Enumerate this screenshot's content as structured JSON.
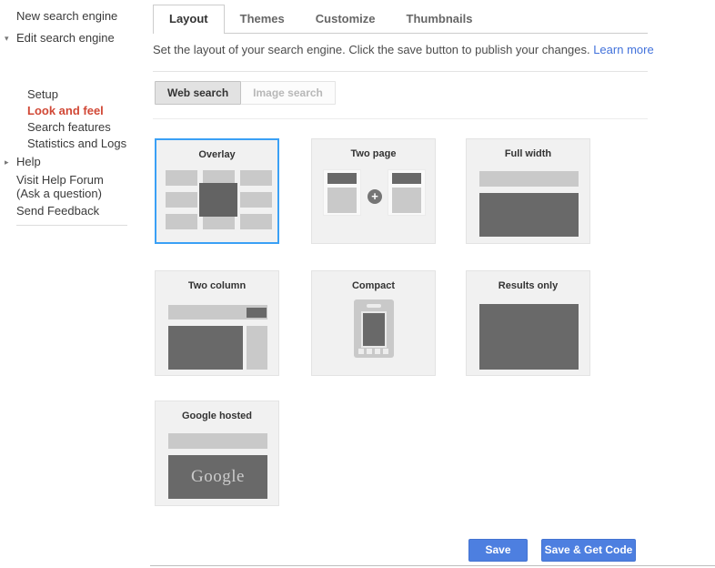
{
  "sidebar": {
    "new_search_engine": "New search engine",
    "edit_search_engine": "Edit search engine",
    "sub_items": [
      "Setup",
      "Look and feel",
      "Search features",
      "Statistics and Logs"
    ],
    "active_item": "Look and feel",
    "help": "Help",
    "help_forum_line1": "Visit Help Forum",
    "help_forum_line2": "(Ask a question)",
    "send_feedback": "Send Feedback"
  },
  "tabs": {
    "items": [
      "Layout",
      "Themes",
      "Customize",
      "Thumbnails"
    ],
    "active": "Layout"
  },
  "description": {
    "text": "Set the layout of your search engine. Click the save button to publish your changes.",
    "link_label": "Learn more"
  },
  "search_type_toggle": {
    "options": [
      "Web search",
      "Image search"
    ],
    "active": "Web search"
  },
  "layouts": [
    {
      "name": "Overlay",
      "selected": true
    },
    {
      "name": "Two page",
      "selected": false
    },
    {
      "name": "Full width",
      "selected": false
    },
    {
      "name": "Two column",
      "selected": false
    },
    {
      "name": "Compact",
      "selected": false
    },
    {
      "name": "Results only",
      "selected": false
    },
    {
      "name": "Google hosted",
      "selected": false,
      "logo_text": "Google"
    }
  ],
  "selected_layout": "Overlay",
  "footer": {
    "save_label": "Save",
    "save_get_code_label": "Save & Get Code"
  },
  "icons": {
    "edit_expander": "triangle-down",
    "help_expander": "triangle-right",
    "two_page_merge": "plus-in-circle"
  },
  "colors": {
    "selected_tile_border": "#3aa0f5",
    "button_blue": "#4d7fe0",
    "link_blue": "#4272db",
    "active_nav_red": "#d14836",
    "tile_bg": "#f1f1f1",
    "block_light": "#c9c9c9",
    "block_dark": "#696969"
  }
}
